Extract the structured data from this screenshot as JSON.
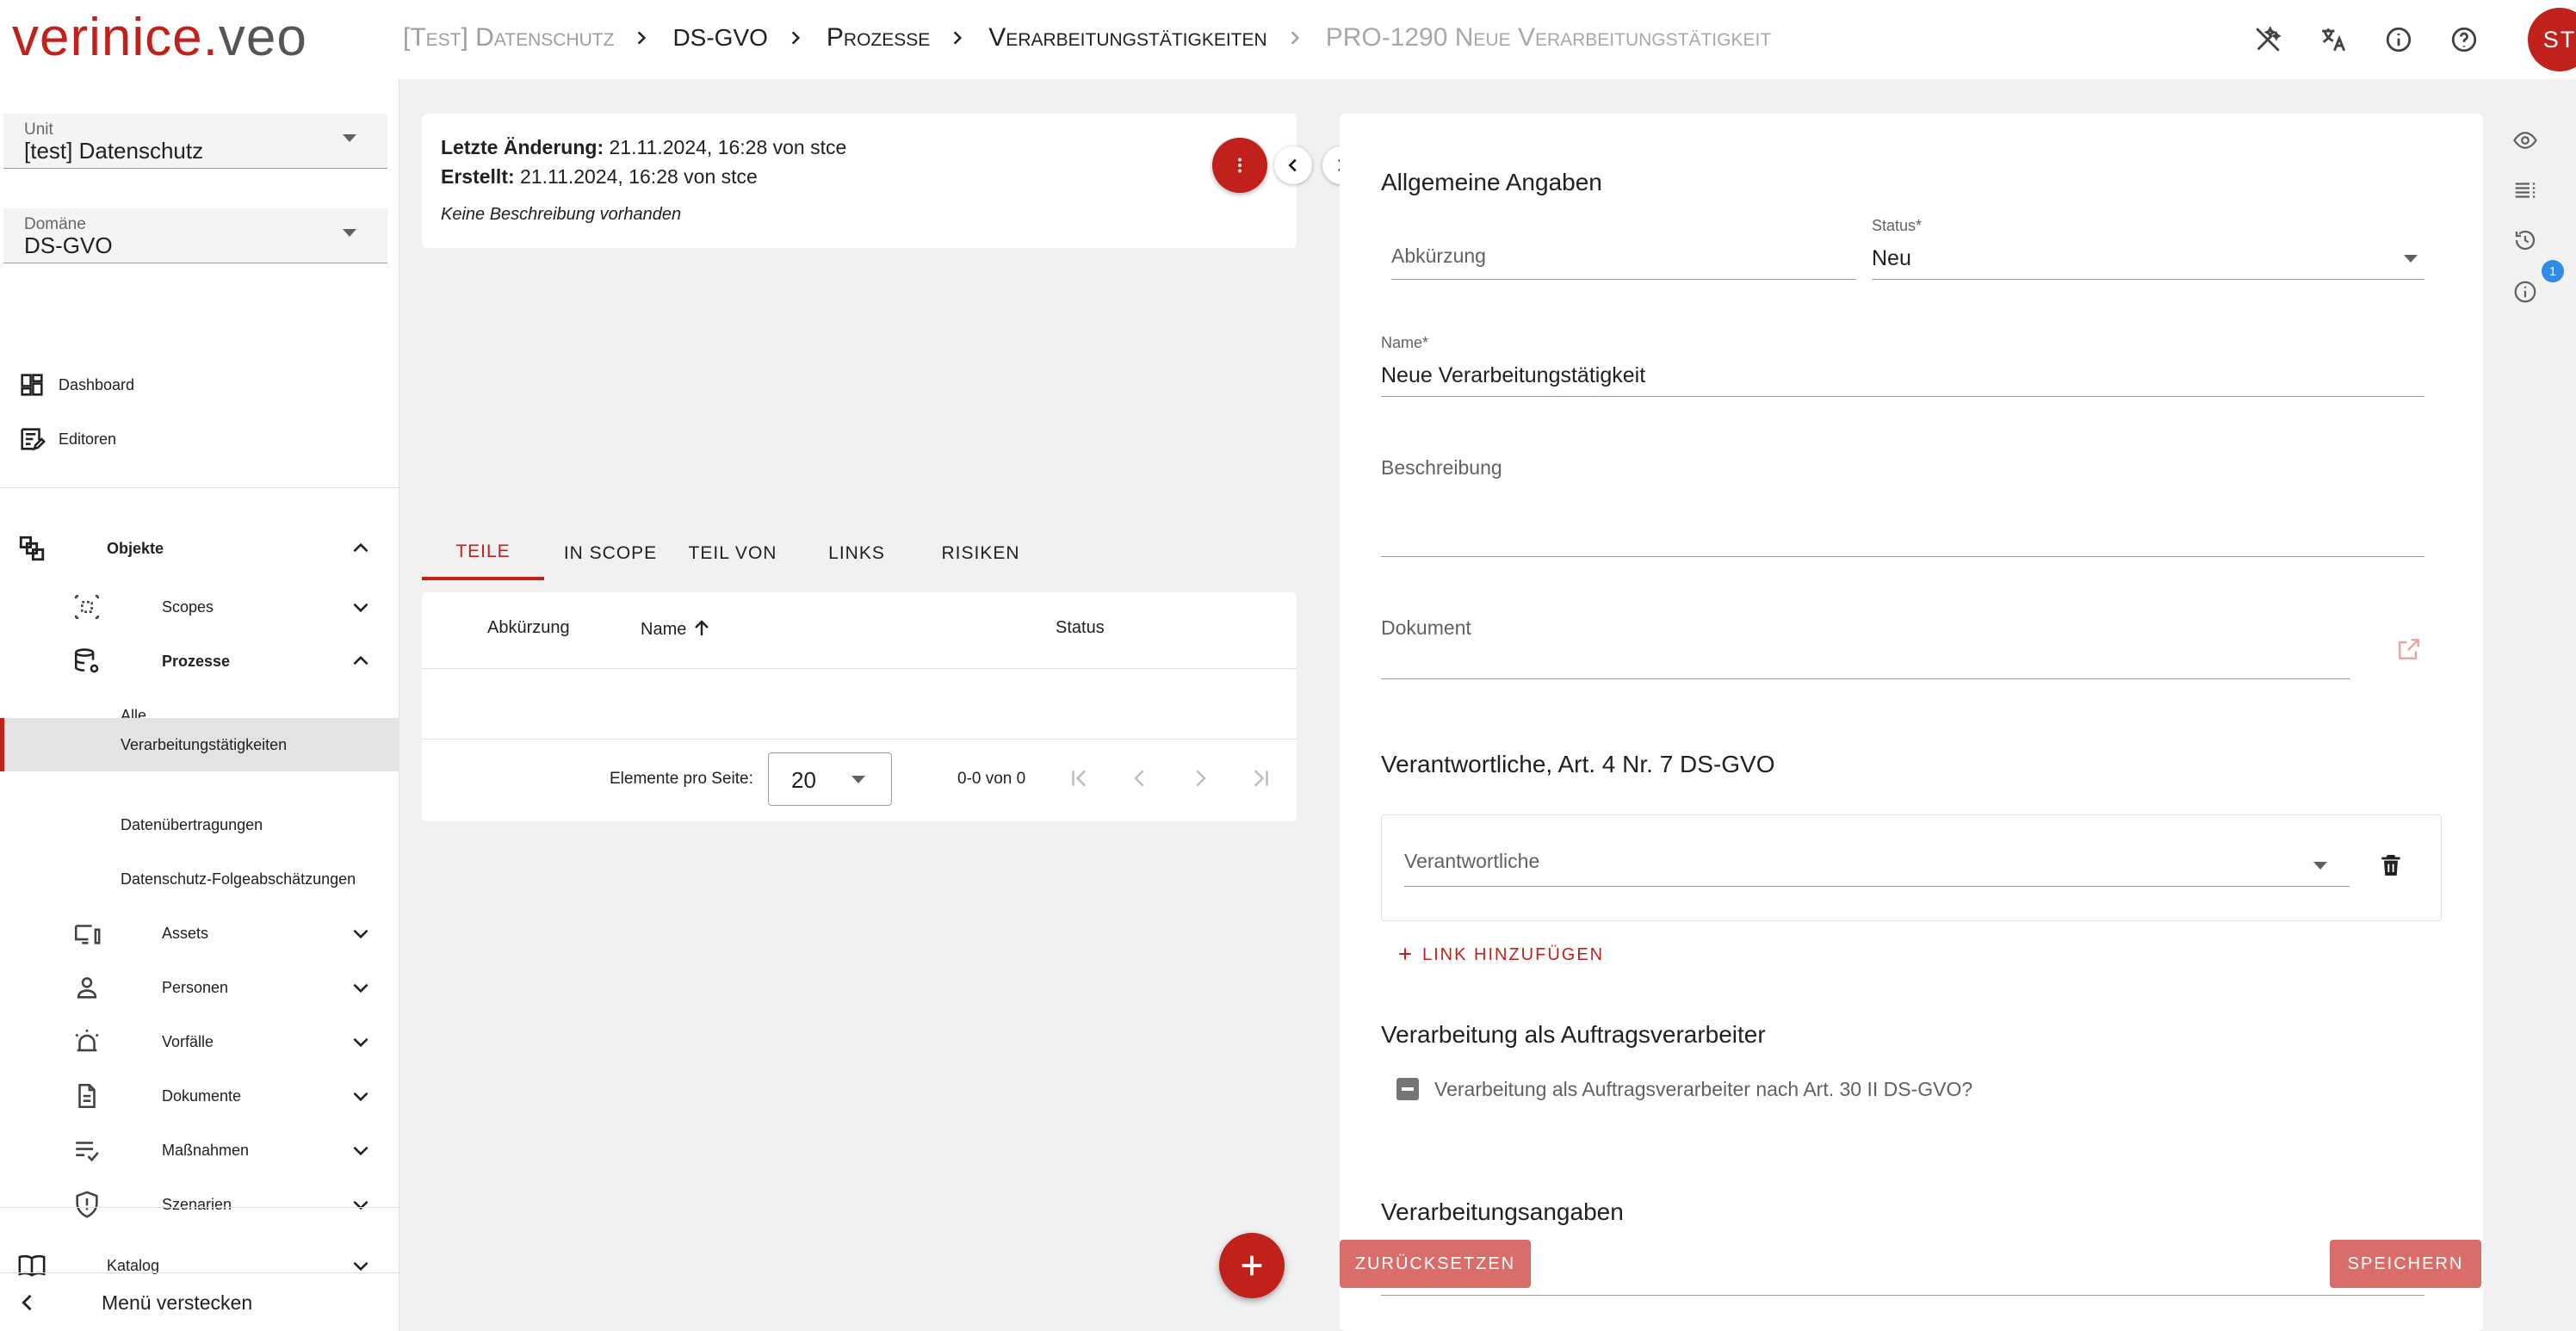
{
  "app": {
    "logo_part1": "verinice",
    "logo_dot": ".",
    "logo_part2": "veo"
  },
  "breadcrumb": [
    {
      "label": "[Test] Datenschutz"
    },
    {
      "label": "DS-GVO"
    },
    {
      "label": "Prozesse"
    },
    {
      "label": "Verarbeitungstätigkeiten"
    },
    {
      "label": "PRO-1290 Neue Verarbeitungstätigkeit"
    }
  ],
  "header": {
    "avatar_initials": "ST",
    "icons": [
      "wand-off-icon",
      "translate-icon",
      "info-icon",
      "help-icon"
    ]
  },
  "sidebar": {
    "unit_label": "Unit",
    "unit_value": "[test] Datenschutz",
    "domain_label": "Domäne",
    "domain_value": "DS-GVO",
    "dashboard": "Dashboard",
    "editors": "Editoren",
    "objects": "Objekte",
    "scopes": "Scopes",
    "processes": "Prozesse",
    "all": "Alle",
    "processing_activities": "Verarbeitungstätigkeiten",
    "data_transfers": "Datenübertragungen",
    "dpia": "Datenschutz-Folgeabschätzungen",
    "assets": "Assets",
    "persons": "Personen",
    "incidents": "Vorfälle",
    "documents": "Dokumente",
    "controls": "Maßnahmen",
    "scenarios": "Szenarien",
    "catalog": "Katalog",
    "hide_menu": "Menü verstecken"
  },
  "info": {
    "last_change_label": "Letzte Änderung:",
    "last_change_value": "21.11.2024, 16:28 von stce",
    "created_label": "Erstellt:",
    "created_value": "21.11.2024, 16:28 von stce",
    "no_description": "Keine Beschreibung vorhanden"
  },
  "tabs": [
    "TEILE",
    "IN SCOPE",
    "TEIL VON",
    "LINKS",
    "RISIKEN"
  ],
  "table": {
    "columns": [
      "Abkürzung",
      "Name",
      "Status"
    ],
    "rows": [],
    "per_page_label": "Elemente pro Seite:",
    "per_page_value": "20",
    "range": "0-0 von 0"
  },
  "form": {
    "section_general": "Allgemeine Angaben",
    "abbreviation_label": "Abkürzung",
    "status_label": "Status*",
    "status_value": "Neu",
    "name_label": "Name*",
    "name_value": "Neue Verarbeitungstätigkeit",
    "description_label": "Beschreibung",
    "document_label": "Dokument",
    "section_controllers": "Verantwortliche, Art. 4 Nr. 7 DS-GVO",
    "controllers_field": "Verantwortliche",
    "add_link": "LINK HINZUFÜGEN",
    "section_processor": "Verarbeitung als Auftragsverarbeiter",
    "processor_checkbox": "Verarbeitung als Auftragsverarbeiter nach Art. 30 II DS-GVO?",
    "section_processing": "Verarbeitungsangaben",
    "reset_button": "ZURÜCKSETZEN",
    "save_button": "SPEICHERN"
  },
  "right_rail": {
    "info_badge": "1"
  },
  "colors": {
    "brand_red": "#c0211a",
    "button_disabled_red": "#d86d69",
    "badge_blue": "#2f8ce6"
  }
}
